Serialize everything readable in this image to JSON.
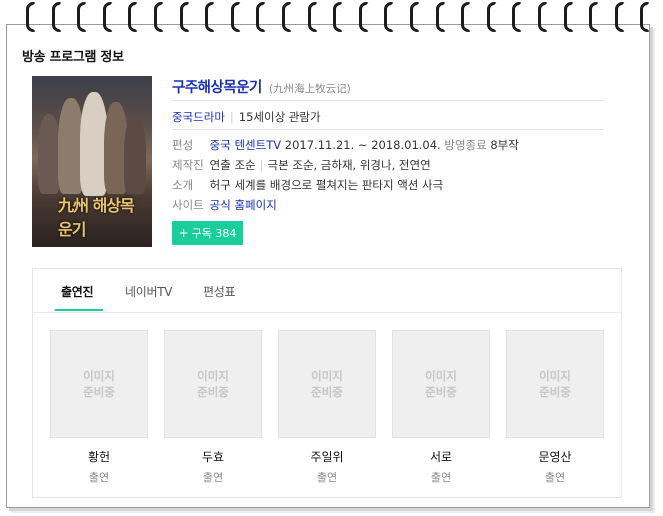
{
  "section_title": "방송 프로그램 정보",
  "program": {
    "title": "구주해상목운기",
    "original_title": "(九州海上牧云记)",
    "genre": "중국드라마",
    "rating": "15세이상 관람가",
    "poster_text": "九州 해상목운기"
  },
  "info": {
    "broadcast": {
      "label": "편성",
      "channel": "중국 텐센트TV",
      "period": "2017.11.21. ~ 2018.01.04.",
      "status": "방영종료",
      "episodes": "8부작"
    },
    "production": {
      "label": "제작진",
      "director": "연출 조순",
      "writers": "극본 조순, 금하재, 위경나, 전연연"
    },
    "intro": {
      "label": "소개",
      "text": "허구 세계를 배경으로 펼쳐지는 판타지 액션 사극"
    },
    "site": {
      "label": "사이트",
      "link": "공식 홈페이지"
    }
  },
  "subscribe": {
    "label": "구독 384"
  },
  "tabs": [
    {
      "label": "출연진",
      "active": true
    },
    {
      "label": "네이버TV",
      "active": false
    },
    {
      "label": "편성표",
      "active": false
    }
  ],
  "cast": [
    {
      "name": "황헌",
      "role": "출연",
      "photo_text_1": "이미지",
      "photo_text_2": "준비중"
    },
    {
      "name": "두효",
      "role": "출연",
      "photo_text_1": "이미지",
      "photo_text_2": "준비중"
    },
    {
      "name": "주일위",
      "role": "출연",
      "photo_text_1": "이미지",
      "photo_text_2": "준비중"
    },
    {
      "name": "서로",
      "role": "출연",
      "photo_text_1": "이미지",
      "photo_text_2": "준비중"
    },
    {
      "name": "문영산",
      "role": "출연",
      "photo_text_1": "이미지",
      "photo_text_2": "준비중"
    }
  ],
  "colors": {
    "accent_green": "#19ce9a",
    "link_blue": "#1a31b5",
    "label_gray": "#888888"
  }
}
